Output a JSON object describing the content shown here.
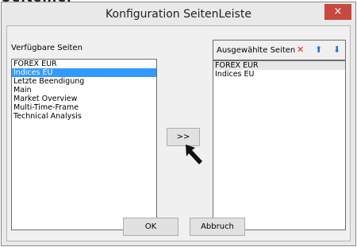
{
  "dialog": {
    "title": "Konfiguration SeitenLeiste",
    "close_icon": "×"
  },
  "available": {
    "label": "Verfügbare Seiten",
    "items": [
      "FOREX EUR",
      "Indices EU",
      "Letzte Beendigung",
      "Main",
      "Market Overview",
      "Multi-Time-Frame",
      "Technical Analysis"
    ],
    "selected_index": 1
  },
  "selected": {
    "label": "Ausgewählte Seiten",
    "items": [
      "FOREX EUR",
      "Indices EU"
    ],
    "highlighted_index": 0,
    "icons": {
      "remove": "delete-x-icon",
      "move_up": "arrow-up-icon",
      "move_down": "arrow-down-icon"
    }
  },
  "buttons": {
    "add": ">>",
    "ok": "OK",
    "cancel": "Abbruch"
  },
  "colors": {
    "selection": "#3399ff",
    "close_button": "#c7483e",
    "delete_icon": "#e02020",
    "arrow_icon": "#2a6fd6"
  }
}
